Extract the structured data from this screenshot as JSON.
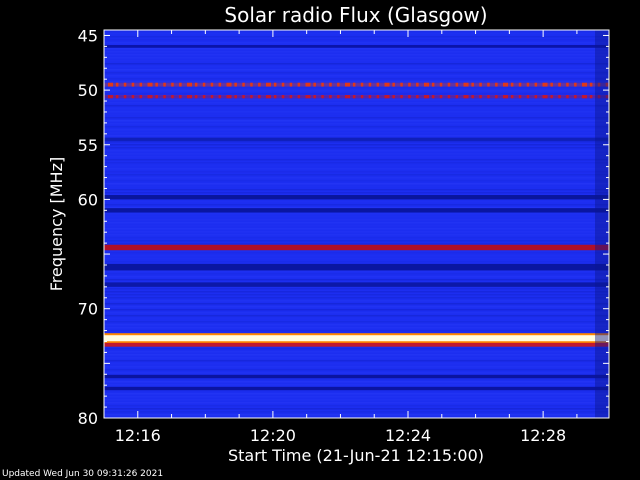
{
  "chart_data": {
    "type": "heatmap",
    "title": "Solar radio Flux (Glasgow)",
    "ylabel": "Frequency [MHz]",
    "xlabel": "Start Time (21-Jun-21 12:15:00)",
    "footer": "Updated Wed Jun 30 09:31:26 2021",
    "y_ticks": [
      45,
      50,
      55,
      60,
      65,
      70,
      75,
      80
    ],
    "y_tick_labels": [
      "45",
      "50",
      "55",
      "60",
      "",
      "70",
      "",
      "80"
    ],
    "ylim": [
      80,
      44.5
    ],
    "x_ticks_minutes": [
      1,
      5,
      9,
      13
    ],
    "x_tick_labels": [
      "12:16",
      "12:20",
      "12:24",
      "12:28"
    ],
    "xlim_minutes": [
      0,
      14.95
    ],
    "background_color": "#1c2ef0",
    "bands": [
      {
        "freq": 46.0,
        "width": 0.25,
        "color": "#0b14a8",
        "intensity": "low"
      },
      {
        "freq": 49.5,
        "width": 0.35,
        "color": "#e03818",
        "intensity": "medium-high",
        "dotted": true
      },
      {
        "freq": 50.6,
        "width": 0.3,
        "color": "#c01830",
        "intensity": "medium-high",
        "dotted": true
      },
      {
        "freq": 54.5,
        "width": 0.3,
        "color": "#1020b8",
        "intensity": "low"
      },
      {
        "freq": 59.8,
        "width": 0.4,
        "color": "#0a169c",
        "intensity": "low"
      },
      {
        "freq": 61.0,
        "width": 0.4,
        "color": "#0a16a0",
        "intensity": "low"
      },
      {
        "freq": 64.4,
        "width": 0.5,
        "color": "#b01028",
        "intensity": "medium"
      },
      {
        "freq": 66.2,
        "width": 0.6,
        "color": "#0a16a0",
        "intensity": "low"
      },
      {
        "freq": 67.8,
        "width": 0.4,
        "color": "#0c18a8",
        "intensity": "low"
      },
      {
        "freq": 72.7,
        "width": 0.55,
        "color": "#fffde0",
        "intensity": "saturated"
      },
      {
        "freq": 73.3,
        "width": 0.35,
        "color": "#c01830",
        "intensity": "medium"
      },
      {
        "freq": 76.2,
        "width": 0.3,
        "color": "#0b14a0",
        "intensity": "low"
      },
      {
        "freq": 77.3,
        "width": 0.3,
        "color": "#0b14a0",
        "intensity": "low"
      }
    ],
    "colors": {
      "background": "#000000",
      "text": "#ffffff",
      "axes": "#ffffff"
    }
  }
}
